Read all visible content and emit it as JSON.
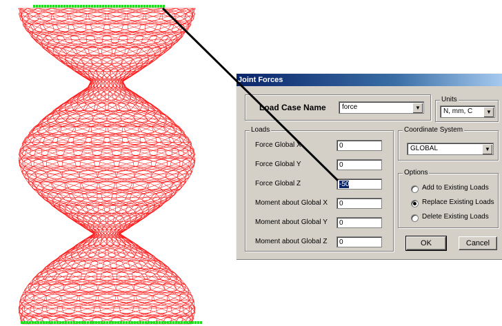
{
  "dialog": {
    "title": "Joint Forces",
    "load_case_label": "Load Case Name",
    "load_case_value": "force",
    "units_label": "Units",
    "units_value": "N, mm, C",
    "loads": {
      "legend": "Loads",
      "rows": [
        {
          "label": "Force Global X",
          "value": "0"
        },
        {
          "label": "Force Global Y",
          "value": "0"
        },
        {
          "label": "Force Global Z",
          "value": "-50"
        },
        {
          "label": "Moment about Global X",
          "value": "0"
        },
        {
          "label": "Moment about Global Y",
          "value": "0"
        },
        {
          "label": "Moment about Global Z",
          "value": "0"
        }
      ]
    },
    "coordinate_system": {
      "legend": "Coordinate System",
      "value": "GLOBAL"
    },
    "options": {
      "legend": "Options",
      "items": [
        {
          "label": "Add to Existing Loads",
          "selected": false
        },
        {
          "label": "Replace Existing Loads",
          "selected": true
        },
        {
          "label": "Delete Existing Loads",
          "selected": false
        }
      ]
    },
    "ok_label": "OK",
    "cancel_label": "Cancel"
  },
  "colors": {
    "mesh": "#ff0000",
    "supports": "#22dd22",
    "leader": "#000000"
  }
}
